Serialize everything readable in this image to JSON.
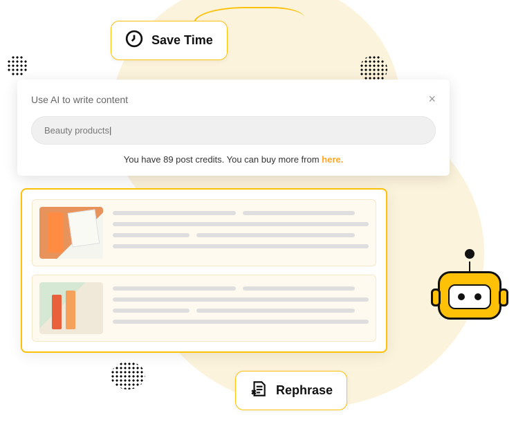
{
  "pills": {
    "top_label": "Save Time",
    "bottom_label": "Rephrase"
  },
  "card": {
    "title": "Use AI to write content",
    "input_value": "Beauty products",
    "credits_prefix": "You have ",
    "credits_count": "89",
    "credits_mid": " post credits. You can buy more from ",
    "credits_link": "here."
  },
  "colors": {
    "accent": "#ffc107",
    "link": "#ffa726"
  }
}
